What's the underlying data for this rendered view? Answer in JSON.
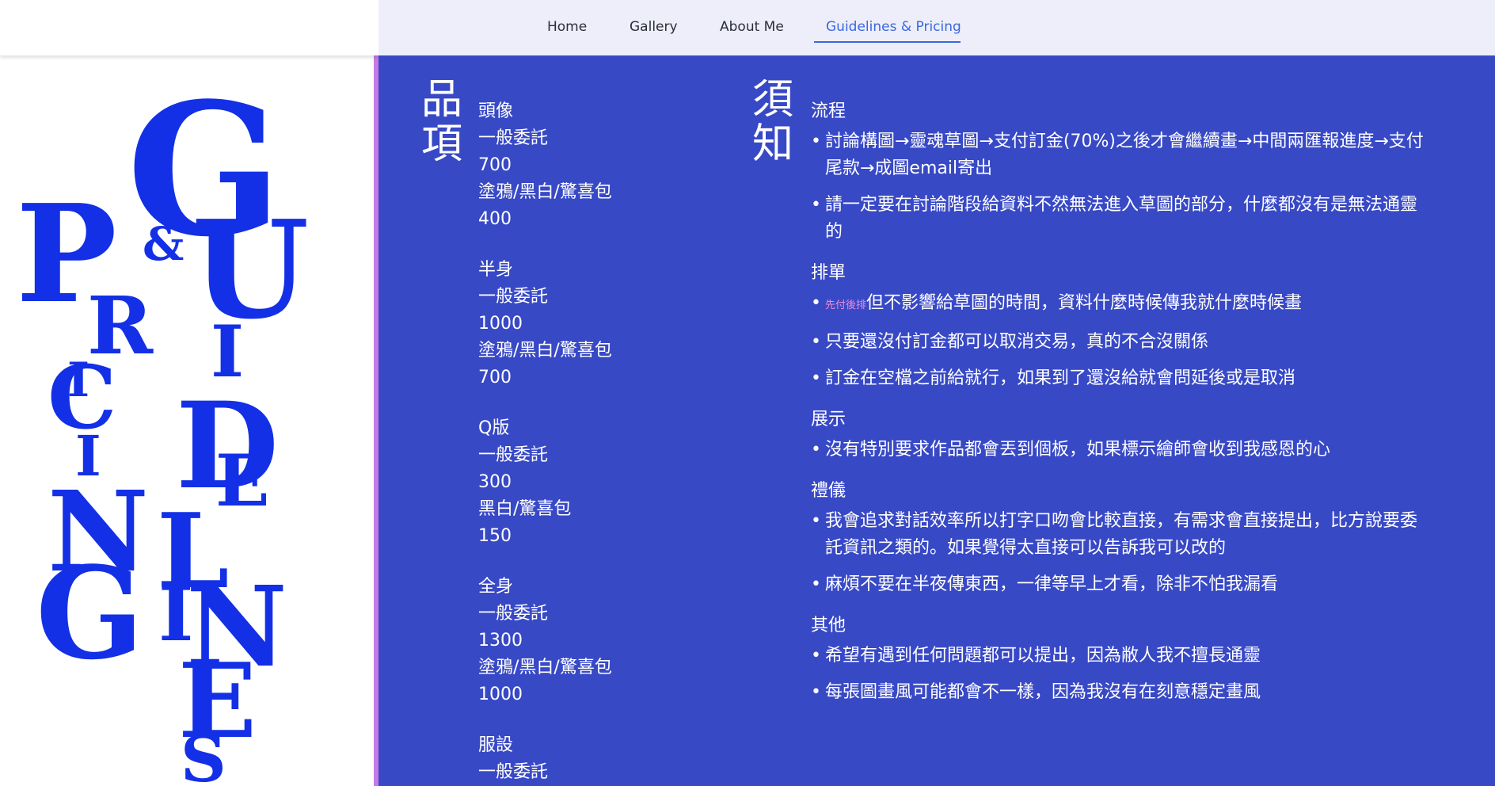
{
  "nav": {
    "items": [
      {
        "label": "Home"
      },
      {
        "label": "Gallery"
      },
      {
        "label": "About Me"
      },
      {
        "label": "Guidelines & Pricing"
      }
    ],
    "active_index": 3
  },
  "art": {
    "letters_text": "PRICING & GUIDELINES",
    "color": "#1330e6"
  },
  "items_heading": "品項",
  "items": [
    {
      "name": "頭像",
      "rows": [
        "一般委託",
        "700",
        "塗鴉/黑白/驚喜包",
        "400"
      ]
    },
    {
      "name": "半身",
      "rows": [
        "一般委託",
        "1000",
        "塗鴉/黑白/驚喜包",
        "700"
      ]
    },
    {
      "name": "Q版",
      "rows": [
        "一般委託",
        "300",
        "黑白/驚喜包",
        "150"
      ]
    },
    {
      "name": "全身",
      "rows": [
        "一般委託",
        "1300",
        "塗鴉/黑白/驚喜包",
        "1000"
      ]
    },
    {
      "name": "服設",
      "rows": [
        "一般委託"
      ]
    }
  ],
  "notice_heading": "須知",
  "sections": [
    {
      "title": "流程",
      "bullets": [
        {
          "tag": "",
          "text": "討論構圖→靈魂草圖→支付訂金(70%)之後才會繼續畫→中間兩匯報進度→支付尾款→成圖email寄出"
        },
        {
          "tag": "",
          "text": "請一定要在討論階段給資料不然無法進入草圖的部分，什麼都沒有是無法通靈的"
        }
      ]
    },
    {
      "title": "排單",
      "bullets": [
        {
          "tag": "先付後排",
          "text": "但不影響給草圖的時間，資料什麼時候傳我就什麼時候畫"
        },
        {
          "tag": "",
          "text": "只要還沒付訂金都可以取消交易，真的不合沒關係"
        },
        {
          "tag": "",
          "text": "訂金在空檔之前給就行，如果到了還沒給就會問延後或是取消"
        }
      ]
    },
    {
      "title": "展示",
      "bullets": [
        {
          "tag": "",
          "text": "沒有特別要求作品都會丟到個板，如果標示繪師會收到我感恩的心"
        }
      ]
    },
    {
      "title": "禮儀",
      "bullets": [
        {
          "tag": "",
          "text": "我會追求對話效率所以打字口吻會比較直接，有需求會直接提出，比方說要委託資訊之類的。如果覺得太直接可以告訴我可以改的"
        },
        {
          "tag": "",
          "text": "麻煩不要在半夜傳東西，一律等早上才看，除非不怕我漏看"
        }
      ]
    },
    {
      "title": "其他",
      "bullets": [
        {
          "tag": "",
          "text": "希望有遇到任何問題都可以提出，因為敝人我不擅長通靈"
        },
        {
          "tag": "",
          "text": "每張圖畫風可能都會不一樣，因為我沒有在刻意穩定畫風"
        }
      ]
    }
  ],
  "colors": {
    "nav_active": "#3a68e0",
    "content_bg": "#3849c6",
    "divider": "#c47be3",
    "tag": "#f08bd8"
  }
}
